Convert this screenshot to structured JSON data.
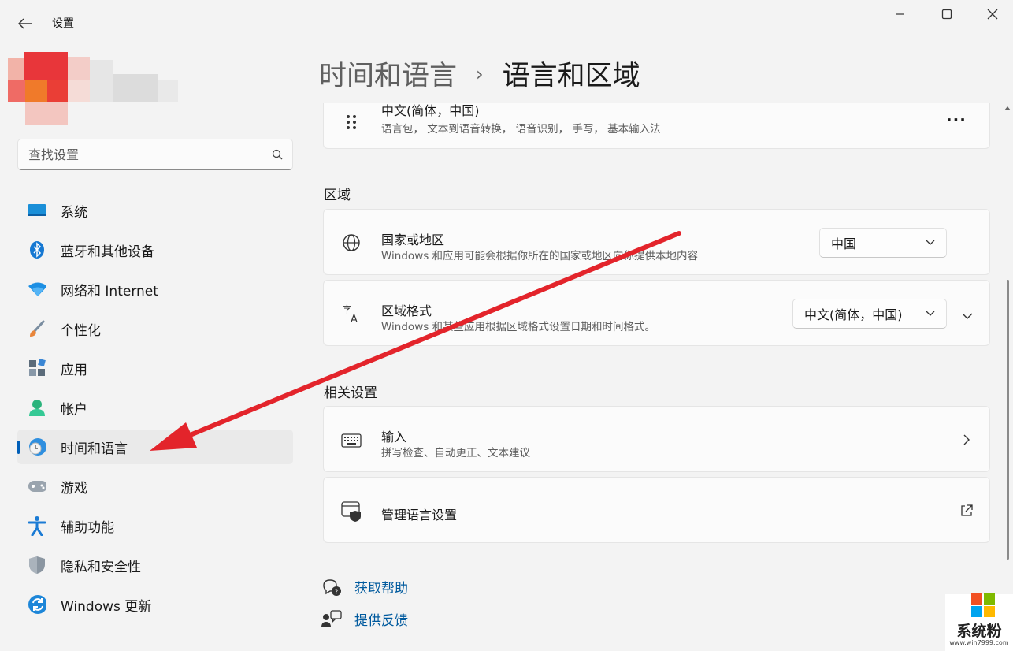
{
  "window": {
    "app_title": "设置",
    "back_icon": "arrow-left-icon",
    "minimize_icon": "minimize-icon",
    "maximize_icon": "maximize-icon",
    "close_icon": "close-icon"
  },
  "search": {
    "placeholder": "查找设置",
    "icon": "search-icon"
  },
  "sidebar": {
    "items": [
      {
        "label": "系统",
        "icon": "system-icon",
        "active": false
      },
      {
        "label": "蓝牙和其他设备",
        "icon": "bluetooth-icon",
        "active": false
      },
      {
        "label": "网络和 Internet",
        "icon": "wifi-icon",
        "active": false
      },
      {
        "label": "个性化",
        "icon": "brush-icon",
        "active": false
      },
      {
        "label": "应用",
        "icon": "apps-icon",
        "active": false
      },
      {
        "label": "帐户",
        "icon": "account-icon",
        "active": false
      },
      {
        "label": "时间和语言",
        "icon": "time-language-icon",
        "active": true
      },
      {
        "label": "游戏",
        "icon": "gamepad-icon",
        "active": false
      },
      {
        "label": "辅助功能",
        "icon": "accessibility-icon",
        "active": false
      },
      {
        "label": "隐私和安全性",
        "icon": "shield-icon",
        "active": false
      },
      {
        "label": "Windows 更新",
        "icon": "update-icon",
        "active": false
      }
    ]
  },
  "breadcrumb": {
    "parent": "时间和语言",
    "separator": "›",
    "current": "语言和区域"
  },
  "language_card": {
    "title": "中文(简体，中国)",
    "subtitle": "语言包， 文本到语音转换， 语音识别， 手写， 基本输入法",
    "more": "···"
  },
  "region_section": {
    "title": "区域",
    "country": {
      "title": "国家或地区",
      "subtitle": "Windows 和应用可能会根据你所在的国家或地区向你提供本地内容",
      "value": "中国"
    },
    "format": {
      "title": "区域格式",
      "subtitle": "Windows 和某些应用根据区域格式设置日期和时间格式。",
      "value": "中文(简体，中国)"
    }
  },
  "related_section": {
    "title": "相关设置",
    "typing": {
      "title": "输入",
      "subtitle": "拼写检查、自动更正、文本建议"
    },
    "admin": {
      "title": "管理语言设置"
    }
  },
  "links": {
    "help": "获取帮助",
    "feedback": "提供反馈"
  },
  "watermark": {
    "text": "系统粉",
    "url": "www.win7999.com"
  },
  "colors": {
    "accent": "#005fb8",
    "annotation_arrow": "#e3242b"
  }
}
